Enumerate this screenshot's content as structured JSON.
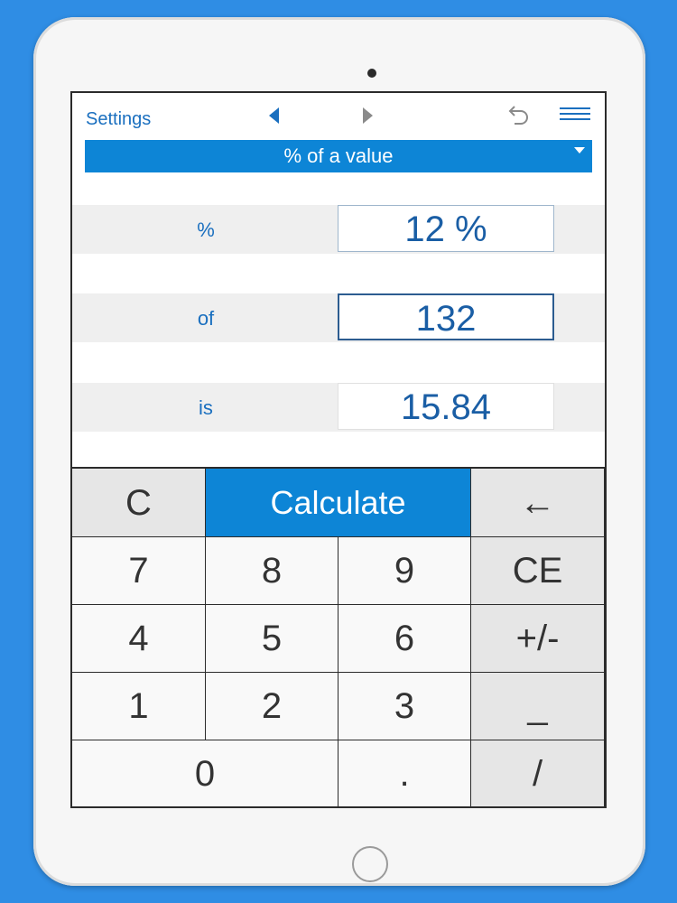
{
  "topbar": {
    "settings_label": "Settings",
    "dropdown_label": "% of a value"
  },
  "rows": [
    {
      "label": "%",
      "value": "12 %"
    },
    {
      "label": "of",
      "value": "132"
    },
    {
      "label": "is",
      "value": "15.84"
    }
  ],
  "keypad": {
    "clear": "C",
    "calculate": "Calculate",
    "backspace": "←",
    "k7": "7",
    "k8": "8",
    "k9": "9",
    "ce": "CE",
    "k4": "4",
    "k5": "5",
    "k6": "6",
    "sign": "+/-",
    "k1": "1",
    "k2": "2",
    "k3": "3",
    "underscore": "_",
    "k0": "0",
    "dot": ".",
    "slash": "/"
  },
  "colors": {
    "accent": "#0d85d6",
    "text_blue": "#1a6fbf",
    "background": "#2f8de4"
  },
  "icons": [
    "prev-arrow-icon",
    "next-arrow-icon",
    "undo-icon",
    "menu-icon",
    "dropdown-caret-icon"
  ]
}
